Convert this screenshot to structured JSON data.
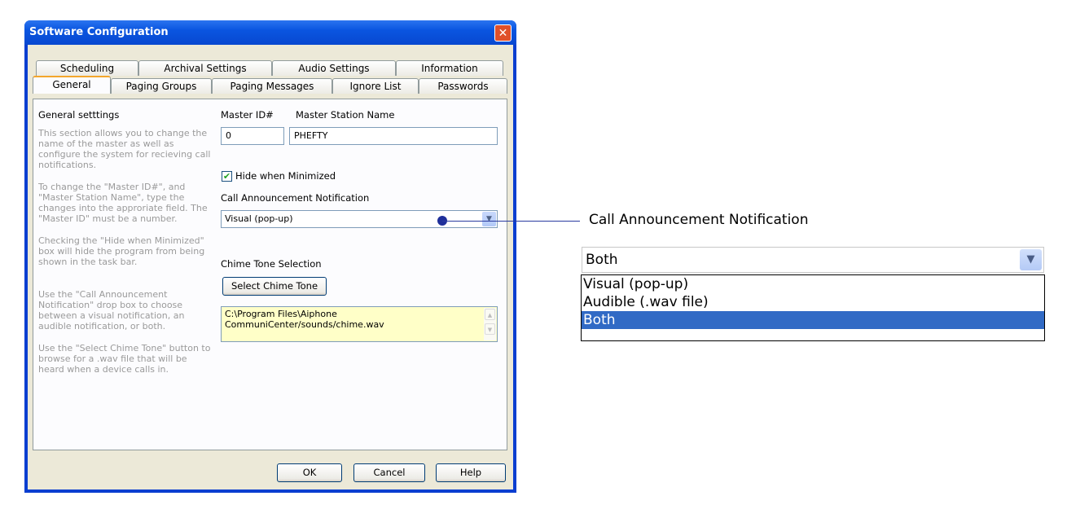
{
  "window": {
    "title": "Software Configuration",
    "close_symbol": "✕"
  },
  "tabs_row1": [
    "Scheduling",
    "Archival Settings",
    "Audio Settings",
    "Information"
  ],
  "tabs_row2": [
    "General",
    "Paging Groups",
    "Paging Messages",
    "Ignore List",
    "Passwords"
  ],
  "active_tab": "General",
  "general": {
    "heading": "General setttings",
    "help1": "This section allows you to change the name of the master as well as configure the system for recieving call notifications.",
    "help2": "To change the \"Master ID#\", and \"Master Station Name\", type the changes into the approriate field. The \"Master ID\" must be a number.",
    "help3": "Checking the \"Hide when Minimized\" box will hide the program from being shown in the task bar.",
    "help4": "Use the \"Call Announcement Notification\" drop box to choose between a visual notification, an audible notification, or both.",
    "help5": "Use the \"Select Chime Tone\" button to browse for a .wav file that will be heard when a device calls in.",
    "master_id_label": "Master ID#",
    "master_id_value": "0",
    "master_name_label": "Master Station Name",
    "master_name_value": "PHEFTY",
    "hide_label": "Hide when Minimized",
    "hide_checked": true,
    "call_label": "Call Announcement Notification",
    "call_value": "Visual (pop-up)",
    "chime_label": "Chime Tone Selection",
    "chime_button": "Select Chime Tone",
    "chime_path": "C:\\Program Files\\Aiphone CommuniCenter/sounds/chime.wav"
  },
  "buttons": {
    "ok": "OK",
    "cancel": "Cancel",
    "help": "Help"
  },
  "zoom": {
    "label": "Call Announcement Notification",
    "value": "Both",
    "options": [
      "Visual (pop-up)",
      "Audible (.wav file)",
      "Both"
    ],
    "selected": "Both"
  },
  "colors": {
    "title_bar": "#0a55e0",
    "selection": "#316ac5",
    "memo_bg": "#ffffc8"
  }
}
